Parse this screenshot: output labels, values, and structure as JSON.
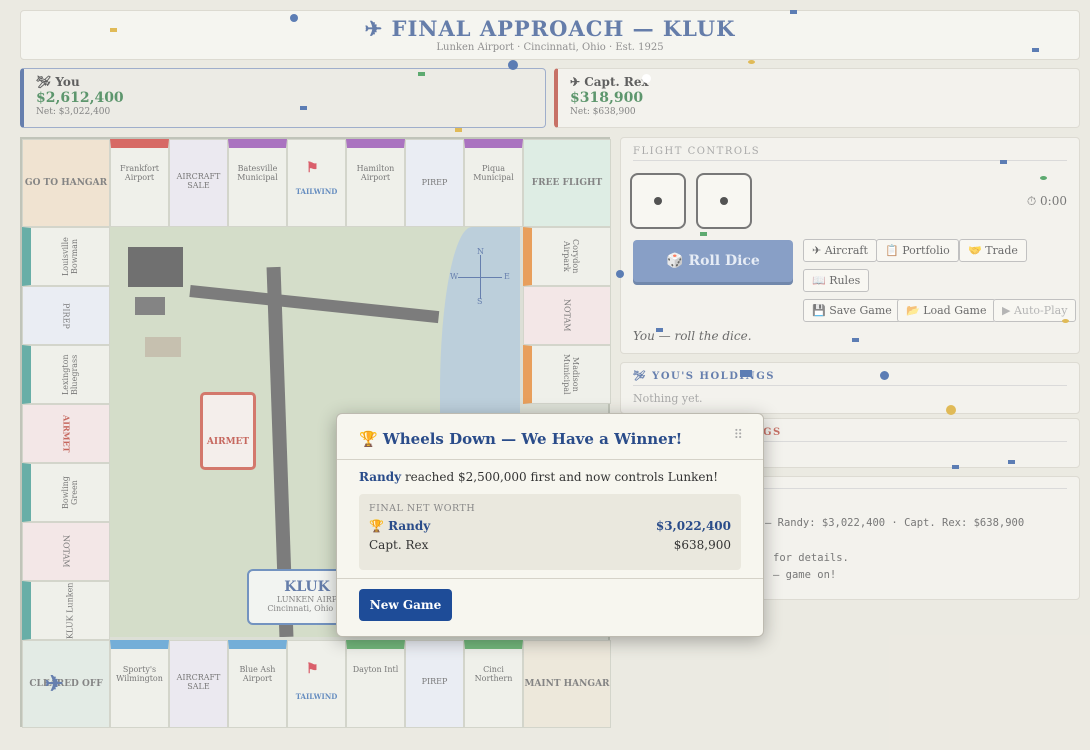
{
  "header": {
    "title": "✈ FINAL APPROACH — KLUK",
    "subtitle": "Lunken Airport · Cincinnati, Ohio · Est. 1925"
  },
  "players": [
    {
      "name": "🛩 You",
      "cash": "$2,612,400",
      "net": "Net: $3,022,400"
    },
    {
      "name": "✈ Capt. Rex",
      "cash": "$318,900",
      "net": "Net: $638,900"
    }
  ],
  "board": {
    "top": [
      "GO TO HANGAR",
      "Frankfort Airport",
      "AIRCRAFT SALE",
      "Batesville Municipal",
      "TAILWIND",
      "Hamilton Airport",
      "PIREP",
      "Piqua Municipal",
      "FREE FLIGHT"
    ],
    "left": [
      "Louisville Bowman",
      "PIREP",
      "Lexington Bluegrass",
      "AIRMET",
      "Bowling Green",
      "NOTAM",
      "KLUK Lunken"
    ],
    "right": [
      "Corydon Airpark",
      "NOTAM",
      "Madison Municipal"
    ],
    "bottom": [
      "CLEARED OFF",
      "Sporty's Wilmington",
      "AIRCRAFT SALE",
      "Blue Ash Airport",
      "TAILWIND",
      "Dayton Intl",
      "PIREP",
      "Cinci Northern",
      "MAINT HANGAR"
    ],
    "airmet_card": "AIRMET",
    "kluk_title": "KLUK",
    "kluk_sub1": "LUNKEN AIRP",
    "kluk_sub2": "Cincinnati, Ohio · E",
    "compass": {
      "n": "N",
      "s": "S",
      "e": "E",
      "w": "W"
    }
  },
  "controls": {
    "title": "FLIGHT CONTROLS",
    "timer": "⏱ 0:00",
    "roll": "🎲 Roll Dice",
    "aircraft": "✈ Aircraft",
    "portfolio": "📋 Portfolio",
    "trade": "🤝 Trade",
    "rules": "📖 Rules",
    "save": "💾 Save Game",
    "load": "📂 Load Game",
    "autoplay": "▶ Auto-Play",
    "status": "You — roll the dice.",
    "dice": [
      1,
      1
    ]
  },
  "holdings": {
    "title": "🛩 YOU'S HOLDINGS",
    "empty": "Nothing yet.",
    "second_title_tail": "GS"
  },
  "log": [
    "— Randy: $3,022,400 · Capt. Rex: $638,900",
    "for details.",
    "— game on!"
  ],
  "modal": {
    "title": "🏆 Wheels Down — We Have a Winner!",
    "winner": "Randy",
    "message": " reached $2,500,000 first and now controls Lunken!",
    "nw_header": "FINAL NET WORTH",
    "rows": [
      {
        "name": "🏆 Randy",
        "value": "$3,022,400"
      },
      {
        "name": "Capt. Rex",
        "value": "$638,900"
      }
    ],
    "button": "New Game",
    "grip": "⠿"
  },
  "colors": {
    "accent": "#2a4c8a",
    "money": "#1f6e35",
    "rex": "#b23b2b"
  }
}
